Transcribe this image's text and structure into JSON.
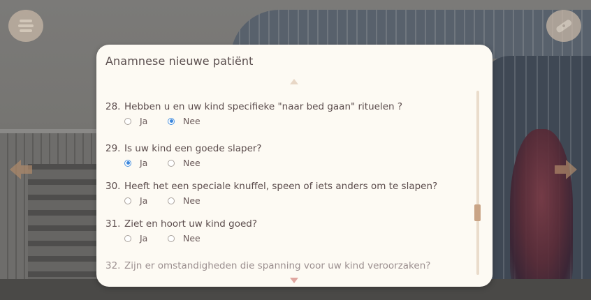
{
  "modal": {
    "title": "Anamnese nieuwe patiënt"
  },
  "questions": [
    {
      "number": "28.",
      "text": "Hebben u en uw kind specifieke \"naar bed gaan\" rituelen ?",
      "options": [
        {
          "label": "Ja",
          "selected": false
        },
        {
          "label": "Nee",
          "selected": true
        }
      ]
    },
    {
      "number": "29.",
      "text": "Is uw kind een goede slaper?",
      "options": [
        {
          "label": "Ja",
          "selected": true
        },
        {
          "label": "Nee",
          "selected": false
        }
      ]
    },
    {
      "number": "30.",
      "text": "Heeft het een speciale knuffel, speen of iets anders om te slapen?",
      "options": [
        {
          "label": "Ja",
          "selected": false
        },
        {
          "label": "Nee",
          "selected": false
        }
      ]
    },
    {
      "number": "31.",
      "text": "Ziet en hoort uw kind goed?",
      "options": [
        {
          "label": "Ja",
          "selected": false
        },
        {
          "label": "Nee",
          "selected": false
        }
      ]
    },
    {
      "number": "32.",
      "text": "Zijn er omstandigheden die spanning voor uw kind veroorzaken?"
    }
  ],
  "icons": {
    "top_left": "menu-stack-icon",
    "top_right": "bandage-icon",
    "nav_left": "arrow-left-icon",
    "nav_right": "arrow-right-icon",
    "scroll_up": "triangle-up-icon",
    "scroll_down": "triangle-down-icon"
  },
  "colors": {
    "modal_bg": "#fdfaf3",
    "text": "#5b4c4c",
    "radio_selected": "#3b86dc",
    "scroll_thumb": "#c9a486"
  }
}
